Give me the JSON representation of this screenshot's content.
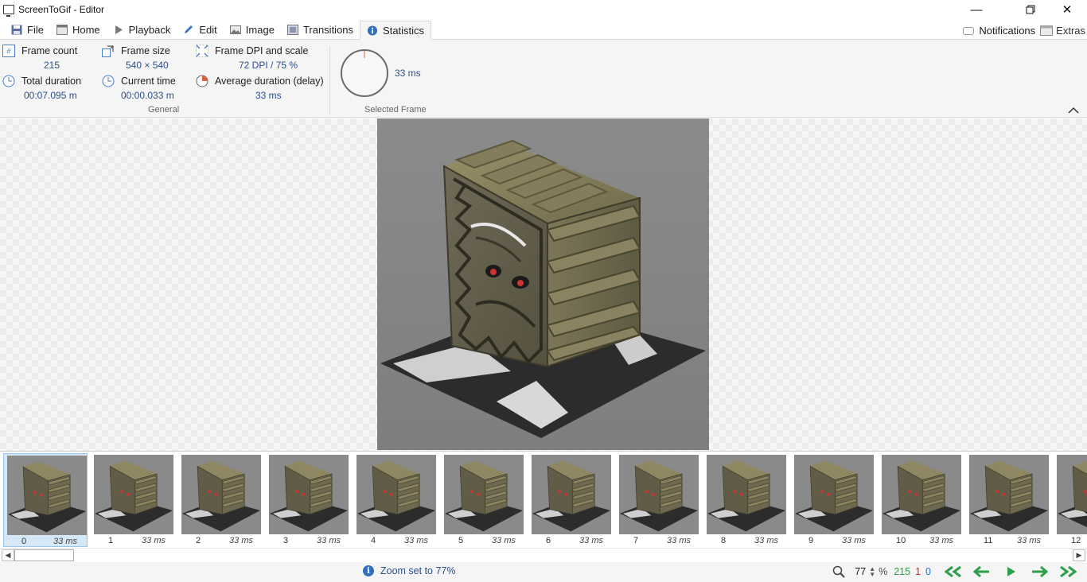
{
  "window": {
    "title": "ScreenToGif - Editor"
  },
  "tabs": [
    {
      "label": "File",
      "icon": "save-icon"
    },
    {
      "label": "Home",
      "icon": "home-icon"
    },
    {
      "label": "Playback",
      "icon": "play-icon"
    },
    {
      "label": "Edit",
      "icon": "pencil-icon"
    },
    {
      "label": "Image",
      "icon": "image-icon"
    },
    {
      "label": "Transitions",
      "icon": "transitions-icon"
    },
    {
      "label": "Statistics",
      "icon": "info-icon",
      "active": true
    }
  ],
  "tabs_right": {
    "notifications": "Notifications",
    "extras": "Extras"
  },
  "statistics": {
    "frame_count": {
      "label": "Frame count",
      "value": "215"
    },
    "frame_size": {
      "label": "Frame size",
      "value": "540 × 540"
    },
    "frame_dpi": {
      "label": "Frame DPI and scale",
      "value": "72 DPI / 75 %"
    },
    "total_duration": {
      "label": "Total duration",
      "value": "00:07.095 m"
    },
    "current_time": {
      "label": "Current time",
      "value": "00:00.033 m"
    },
    "average_duration": {
      "label": "Average duration (delay)",
      "value": "33 ms"
    },
    "general_label": "General",
    "selected_frame_label": "Selected Frame",
    "selected_frame_value": "33 ms"
  },
  "frames": [
    {
      "num": "0",
      "dur": "33 ms"
    },
    {
      "num": "1",
      "dur": "33 ms"
    },
    {
      "num": "2",
      "dur": "33 ms"
    },
    {
      "num": "3",
      "dur": "33 ms"
    },
    {
      "num": "4",
      "dur": "33 ms"
    },
    {
      "num": "5",
      "dur": "33 ms"
    },
    {
      "num": "6",
      "dur": "33 ms"
    },
    {
      "num": "7",
      "dur": "33 ms"
    },
    {
      "num": "8",
      "dur": "33 ms"
    },
    {
      "num": "9",
      "dur": "33 ms"
    },
    {
      "num": "10",
      "dur": "33 ms"
    },
    {
      "num": "11",
      "dur": "33 ms"
    },
    {
      "num": "12",
      "dur": ""
    }
  ],
  "status": {
    "message": "Zoom set to 77%",
    "zoom": "77",
    "percent": "%",
    "total_frames": "215",
    "selected_count": "1",
    "selected_index": "0"
  },
  "colors": {
    "accent_blue": "#2b4f8c",
    "nav_green": "#2f9e4a",
    "count_red": "#c62828"
  }
}
